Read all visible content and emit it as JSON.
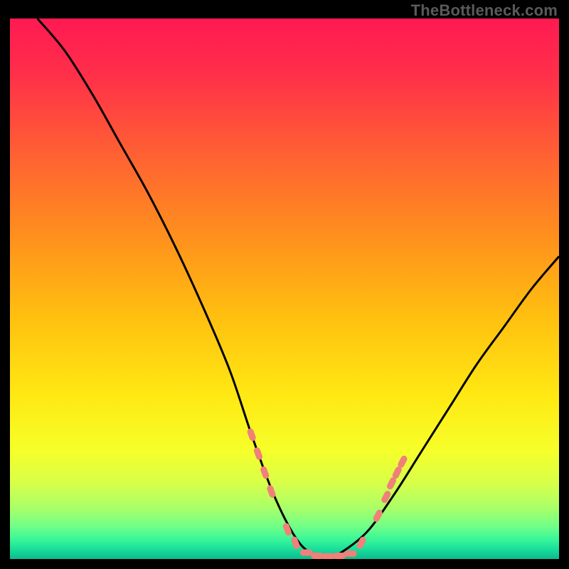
{
  "attribution": "TheBottleneck.com",
  "chart_data": {
    "type": "line",
    "title": "",
    "xlabel": "",
    "ylabel": "",
    "xlim": [
      0,
      100
    ],
    "ylim": [
      0,
      100
    ],
    "curve": {
      "name": "bottleneck-curve",
      "x": [
        5,
        10,
        15,
        20,
        25,
        30,
        35,
        40,
        44,
        48,
        52,
        55,
        58,
        60,
        65,
        70,
        75,
        80,
        85,
        90,
        95,
        100
      ],
      "y": [
        100,
        94,
        86,
        77,
        68,
        58,
        47,
        35,
        23,
        12,
        4,
        1,
        0.5,
        1,
        5,
        12,
        20,
        28,
        36,
        43,
        50,
        56
      ]
    },
    "dashed_markers": {
      "name": "highlight-dots",
      "color": "#f08079",
      "points": [
        {
          "x": 44.0,
          "y": 23.0
        },
        {
          "x": 45.2,
          "y": 19.5
        },
        {
          "x": 46.4,
          "y": 16.0
        },
        {
          "x": 47.6,
          "y": 12.5
        },
        {
          "x": 50.5,
          "y": 5.5
        },
        {
          "x": 52.0,
          "y": 3.0
        },
        {
          "x": 54.0,
          "y": 1.2
        },
        {
          "x": 56.0,
          "y": 0.6
        },
        {
          "x": 58.0,
          "y": 0.5
        },
        {
          "x": 60.0,
          "y": 0.6
        },
        {
          "x": 62.0,
          "y": 1.0
        },
        {
          "x": 64.0,
          "y": 3.0
        },
        {
          "x": 67.0,
          "y": 8.0
        },
        {
          "x": 68.5,
          "y": 11.5
        },
        {
          "x": 69.5,
          "y": 14.0
        },
        {
          "x": 70.5,
          "y": 16.0
        },
        {
          "x": 71.5,
          "y": 18.0
        }
      ]
    },
    "background": {
      "type": "vertical-gradient",
      "stops": [
        {
          "offset": 0.0,
          "color": "#ff1a52"
        },
        {
          "offset": 0.1,
          "color": "#ff2e4a"
        },
        {
          "offset": 0.25,
          "color": "#ff6033"
        },
        {
          "offset": 0.4,
          "color": "#ff8f1e"
        },
        {
          "offset": 0.55,
          "color": "#ffbf10"
        },
        {
          "offset": 0.7,
          "color": "#ffe913"
        },
        {
          "offset": 0.8,
          "color": "#f6ff2a"
        },
        {
          "offset": 0.86,
          "color": "#d7ff49"
        },
        {
          "offset": 0.905,
          "color": "#aaff68"
        },
        {
          "offset": 0.94,
          "color": "#70ff88"
        },
        {
          "offset": 0.965,
          "color": "#36f59a"
        },
        {
          "offset": 0.985,
          "color": "#14d99a"
        },
        {
          "offset": 1.0,
          "color": "#0fb98e"
        }
      ]
    }
  }
}
